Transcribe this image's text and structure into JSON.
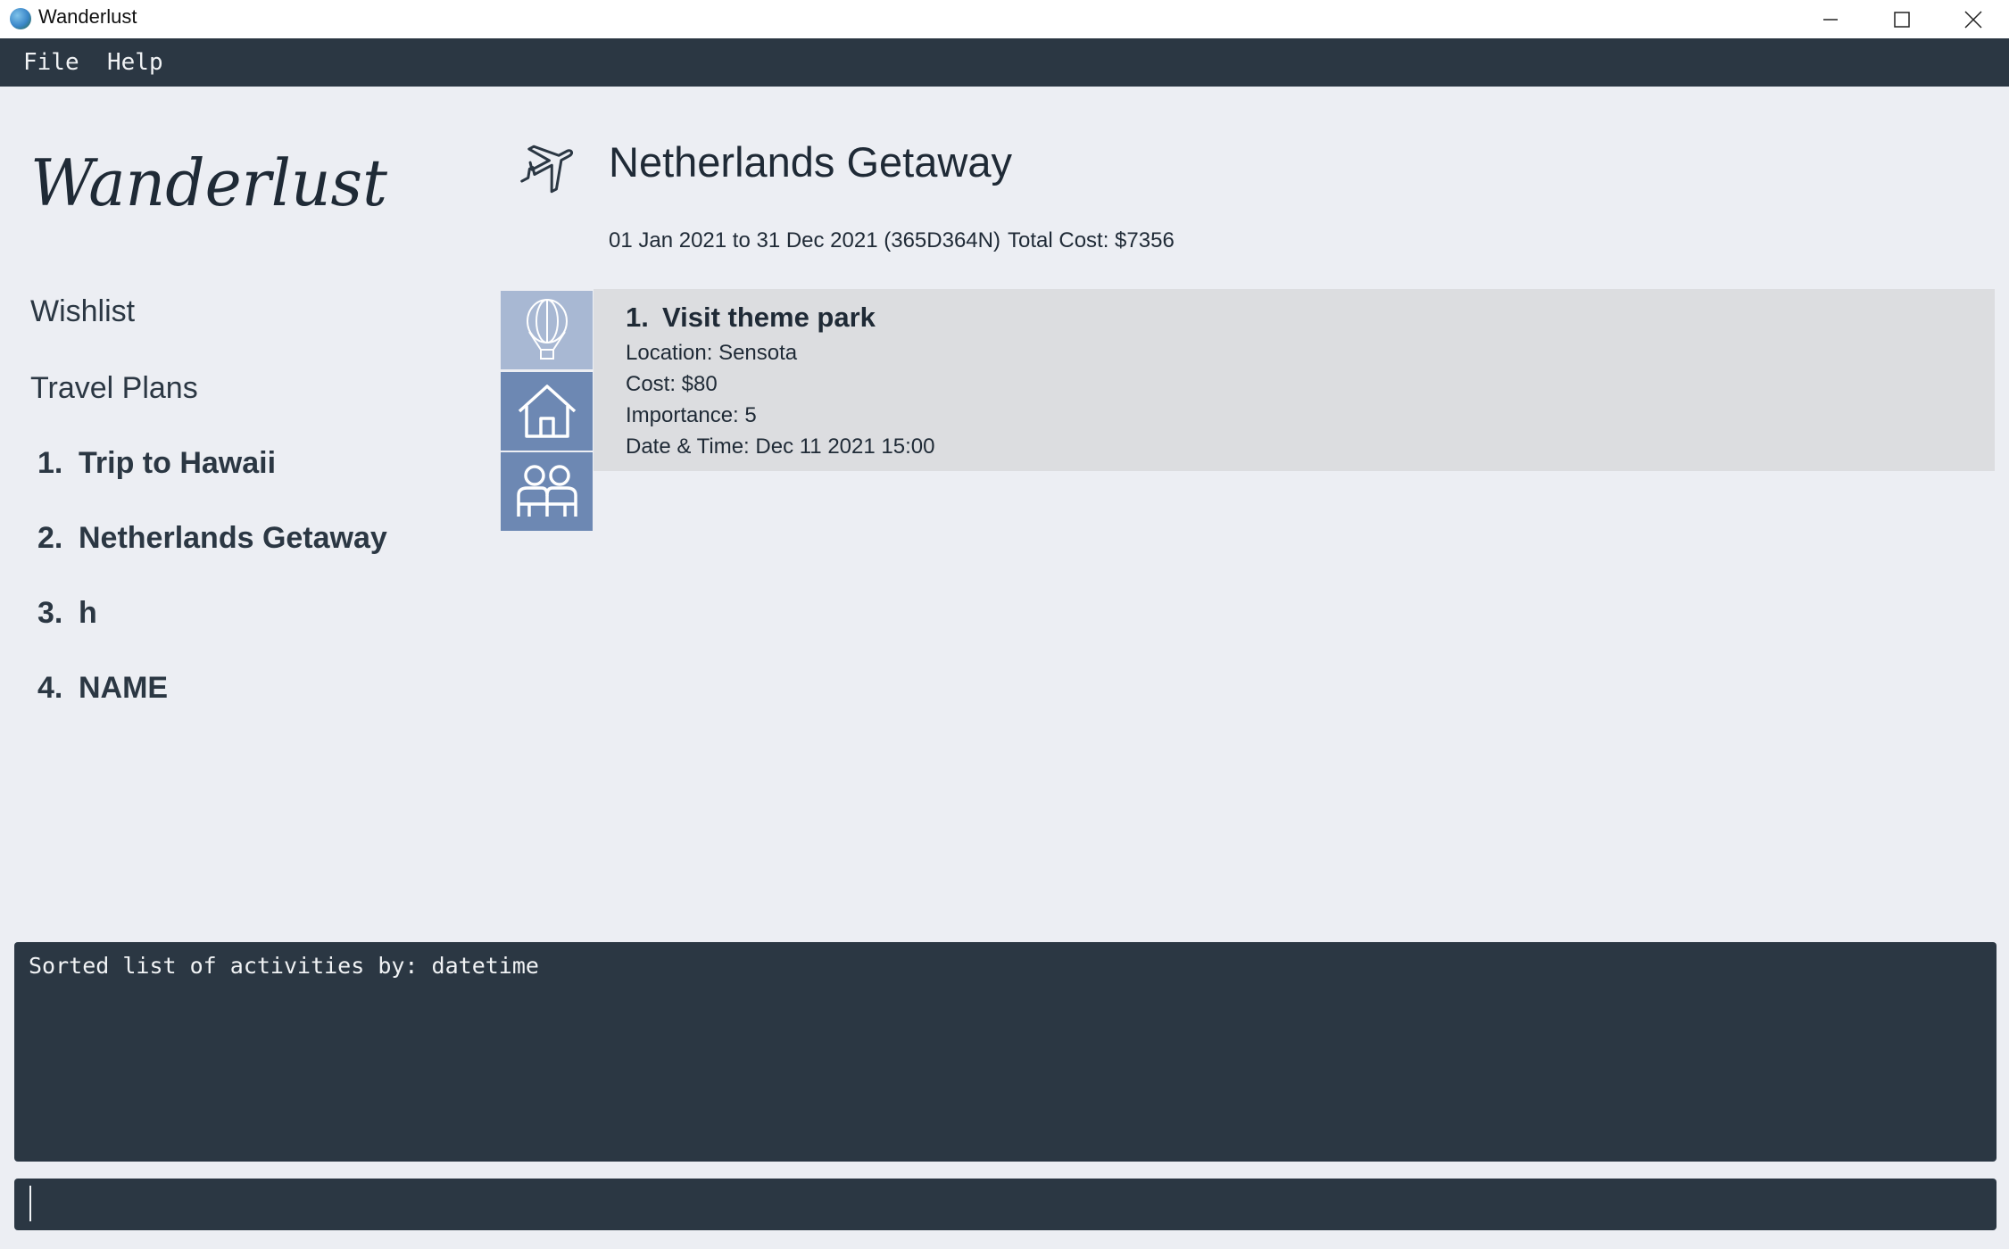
{
  "window": {
    "title": "Wanderlust"
  },
  "menu": {
    "file_label": "File",
    "help_label": "Help"
  },
  "sidebar": {
    "logo_text": "Wanderlust",
    "wishlist_label": "Wishlist",
    "travel_plans_label": "Travel Plans",
    "plans": [
      {
        "index": "1.",
        "name": "Trip to Hawaii"
      },
      {
        "index": "2.",
        "name": "Netherlands Getaway"
      },
      {
        "index": "3.",
        "name": "h"
      },
      {
        "index": "4.",
        "name": "NAME"
      }
    ]
  },
  "plan": {
    "title": "Netherlands Getaway",
    "dates": "01 Jan 2021 to 31 Dec 2021 (365D364N)",
    "total_cost": "Total Cost: $7356"
  },
  "tabs": {
    "activities_icon": "hot-air-balloon-icon",
    "accommodation_icon": "house-icon",
    "friends_icon": "friends-icon"
  },
  "activities": [
    {
      "index": "1.",
      "name": "Visit theme park",
      "location": "Location: Sensota",
      "cost": "Cost: $80",
      "importance": "Importance: 5",
      "datetime": "Date & Time: Dec 11 2021 15:00"
    }
  ],
  "result": {
    "message": "Sorted list of activities by: datetime"
  },
  "command": {
    "value": ""
  },
  "colors": {
    "background": "#eceef3",
    "dark_panel": "#2b3743",
    "tab_active": "#a8b8d3",
    "tab_inactive": "#6d88b3",
    "card": "#dcdde0"
  }
}
